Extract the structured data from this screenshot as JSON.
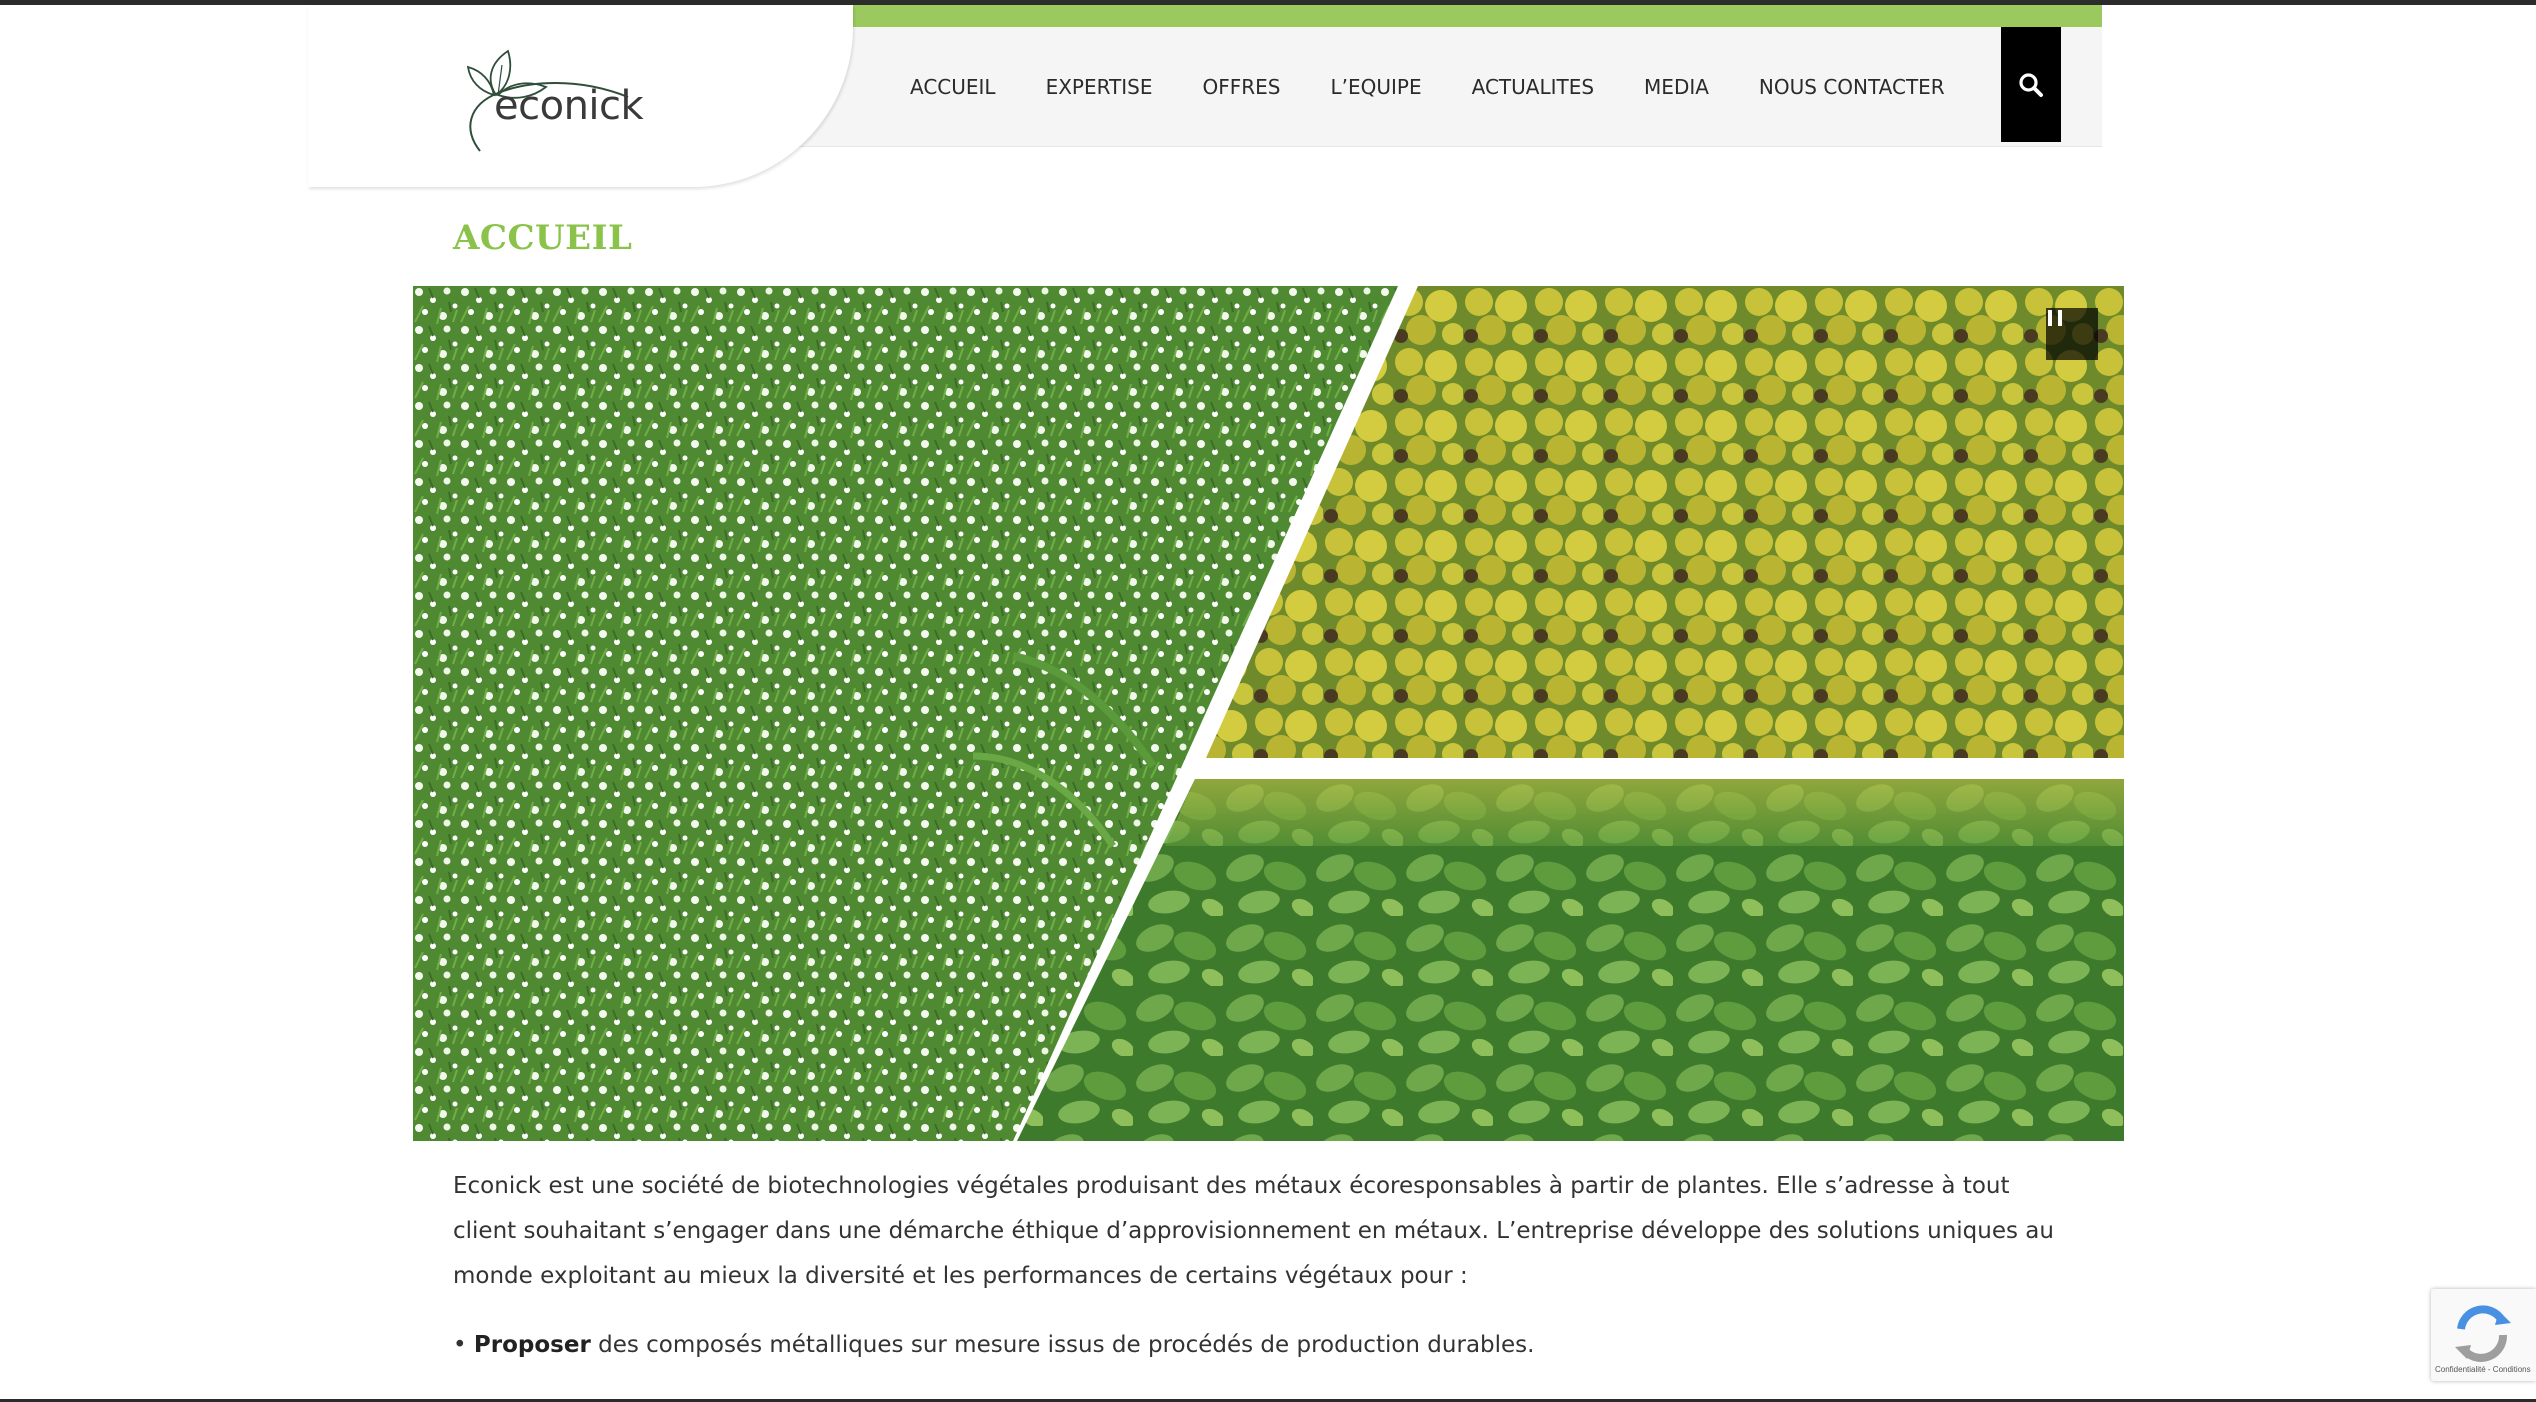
{
  "logo": {
    "text": "econick"
  },
  "nav": {
    "items": [
      {
        "label": "ACCUEIL",
        "name": "nav-accueil"
      },
      {
        "label": "EXPERTISE",
        "name": "nav-expertise"
      },
      {
        "label": "OFFRES",
        "name": "nav-offres"
      },
      {
        "label": "L’EQUIPE",
        "name": "nav-equipe"
      },
      {
        "label": "ACTUALITES",
        "name": "nav-actualites"
      },
      {
        "label": "MEDIA",
        "name": "nav-media"
      },
      {
        "label": "NOUS CONTACTER",
        "name": "nav-contact"
      }
    ],
    "search_icon": "search-icon"
  },
  "page": {
    "title": "ACCUEIL"
  },
  "slider": {
    "pause_icon": "pause-icon"
  },
  "content": {
    "intro": "Econick est une société de biotechnologies végétales produisant des métaux écoresponsables à partir de plantes. Elle s’adresse à tout client souhaitant s’engager dans une démarche éthique d’approvisionnement en métaux. L’entreprise développe des solutions uniques au monde exploitant au mieux la diversité et les performances de certains végétaux pour :",
    "bullet_marker": "•",
    "bullet_bold": "Proposer",
    "bullet_text": " des composés métalliques sur mesure issus de procédés de production durables."
  },
  "recaptcha": {
    "label": "Confidentialité - Conditions"
  },
  "colors": {
    "accent_green": "#9bc95d",
    "title_green": "#8bc34a",
    "search_bg": "#000000"
  }
}
